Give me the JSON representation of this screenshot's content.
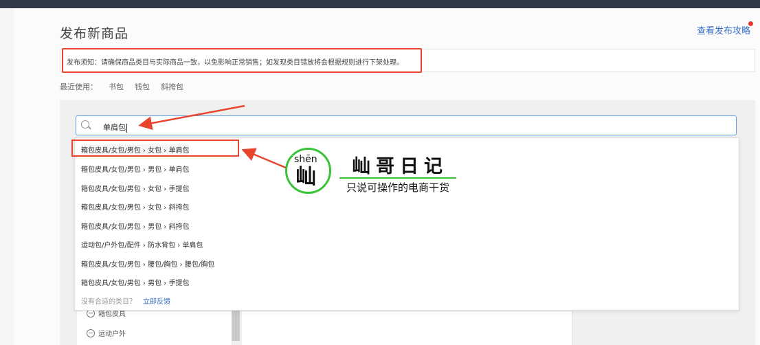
{
  "page": {
    "title": "发布新商品",
    "guide_link": "查看发布攻略",
    "notice": "发布须知：请确保商品类目与实际商品一致，以免影响正常销售；如发现类目错放将会根据规则进行下架处理。"
  },
  "recent": {
    "label": "最近使用：",
    "items": [
      "书包",
      "钱包",
      "斜挎包"
    ]
  },
  "search": {
    "value": "单肩包"
  },
  "results": [
    "箱包皮具/女包/男包 › 女包 › 单肩包",
    "箱包皮具/女包/男包 › 男包 › 单肩包",
    "箱包皮具/女包/男包 › 女包 › 手提包",
    "箱包皮具/女包/男包 › 女包 › 斜挎包",
    "箱包皮具/女包/男包 › 男包 › 斜挎包",
    "运动包/户外包/配件 › 防水背包 › 单肩包",
    "箱包皮具/女包/男包 › 腰包/胸包 › 腰包/胸包",
    "箱包皮具/女包/男包 › 男包 › 手提包"
  ],
  "feedback": {
    "text": "没有合适的类目？",
    "link": "立即反馈"
  },
  "categories": [
    "箱包皮具",
    "运动户外"
  ],
  "watermark": {
    "pinyin": "shēn",
    "char": "屾",
    "brand": "屾哥日记",
    "slogan": "只说可操作的电商干货"
  },
  "colors": {
    "highlight": "#e8452c",
    "link": "#3a6fc7",
    "search_border": "#5a9be0",
    "logo_green": "#36c436"
  }
}
